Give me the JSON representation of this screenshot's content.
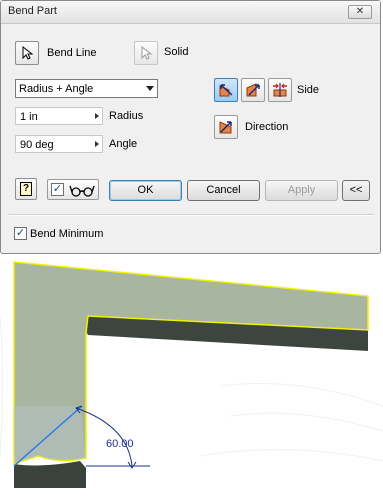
{
  "dialog": {
    "title": "Bend Part",
    "close_label": "✕",
    "bend_line_label": "Bend Line",
    "solid_label": "Solid",
    "method": {
      "selected": "Radius + Angle"
    },
    "radius": {
      "value": "1 in",
      "label": "Radius"
    },
    "angle": {
      "value": "90 deg",
      "label": "Angle"
    },
    "side_label": "Side",
    "direction_label": "Direction",
    "help_label": "?",
    "ok_label": "OK",
    "cancel_label": "Cancel",
    "apply_label": "Apply",
    "more_label": "<<",
    "bend_minimum": {
      "label": "Bend Minimum",
      "checked": true
    },
    "preview_checked": true
  },
  "viewport": {
    "angle_dimension": "60.00",
    "colors": {
      "part_face": "#a8b5a1",
      "part_edge": "#f2f200",
      "shadow": "#3d463e",
      "dimension": "#1a2f8c",
      "bend_line": "#2a7ae8"
    }
  },
  "icons": [
    "select-arrow-icon",
    "select-arrow-icon",
    "flip-side-icon",
    "side-icon",
    "both-sides-icon",
    "direction-icon",
    "help-icon",
    "glasses-icon"
  ]
}
